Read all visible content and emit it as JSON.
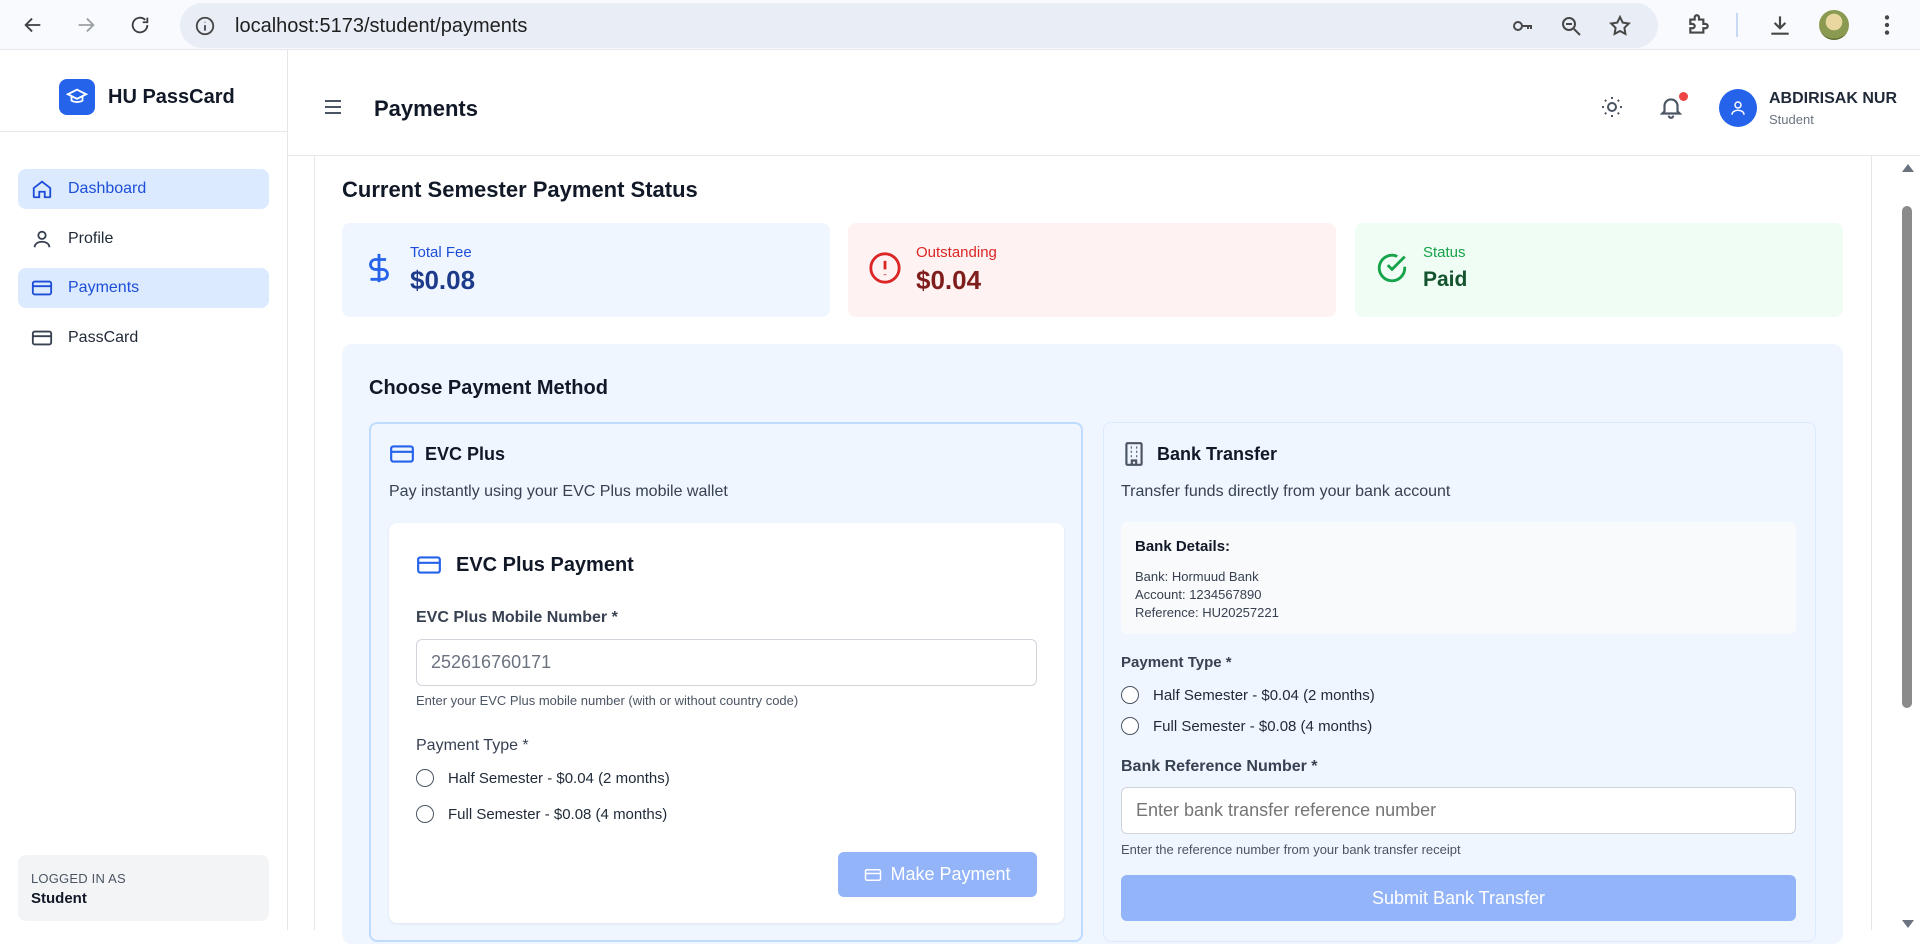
{
  "browser": {
    "url": "localhost:5173/student/payments"
  },
  "sidebar": {
    "brand": "HU PassCard",
    "items": [
      {
        "label": "Dashboard",
        "icon": "home-icon",
        "active": true
      },
      {
        "label": "Profile",
        "icon": "user-icon",
        "active": false
      },
      {
        "label": "Payments",
        "icon": "credit-card-icon",
        "active": true
      },
      {
        "label": "PassCard",
        "icon": "card-icon",
        "active": false
      }
    ],
    "logged_in_label": "LOGGED IN AS",
    "logged_in_role": "Student"
  },
  "header": {
    "title": "Payments",
    "user_name": "ABDIRISAK NUR",
    "user_role": "Student"
  },
  "status": {
    "title": "Current Semester Payment Status",
    "total_fee_label": "Total Fee",
    "total_fee_value": "$0.08",
    "outstanding_label": "Outstanding",
    "outstanding_value": "$0.04",
    "status_label": "Status",
    "status_value": "Paid"
  },
  "methods": {
    "title": "Choose Payment Method",
    "evc": {
      "title": "EVC Plus",
      "description": "Pay instantly using your EVC Plus mobile wallet",
      "form_title": "EVC Plus Payment",
      "mobile_label": "EVC Plus Mobile Number *",
      "mobile_value": "252616760171",
      "mobile_help": "Enter your EVC Plus mobile number (with or without country code)",
      "payment_type_label": "Payment Type *",
      "option_half": "Half Semester - $0.04 (2 months)",
      "option_full": "Full Semester - $0.08 (4 months)",
      "submit_label": "Make Payment"
    },
    "bank": {
      "title": "Bank Transfer",
      "description": "Transfer funds directly from your bank account",
      "details_title": "Bank Details:",
      "bank_line": "Bank: Hormuud Bank",
      "account_line": "Account: 1234567890",
      "reference_line": "Reference: HU20257221",
      "payment_type_label": "Payment Type *",
      "option_half": "Half Semester - $0.04 (2 months)",
      "option_full": "Full Semester - $0.08 (4 months)",
      "reference_label": "Bank Reference Number *",
      "reference_placeholder": "Enter bank transfer reference number",
      "reference_help": "Enter the reference number from your bank transfer receipt",
      "submit_label": "Submit Bank Transfer"
    }
  },
  "colors": {
    "primary": "#2563eb",
    "active_bg": "#dbeafe",
    "button_disabled": "#93b4f8"
  }
}
